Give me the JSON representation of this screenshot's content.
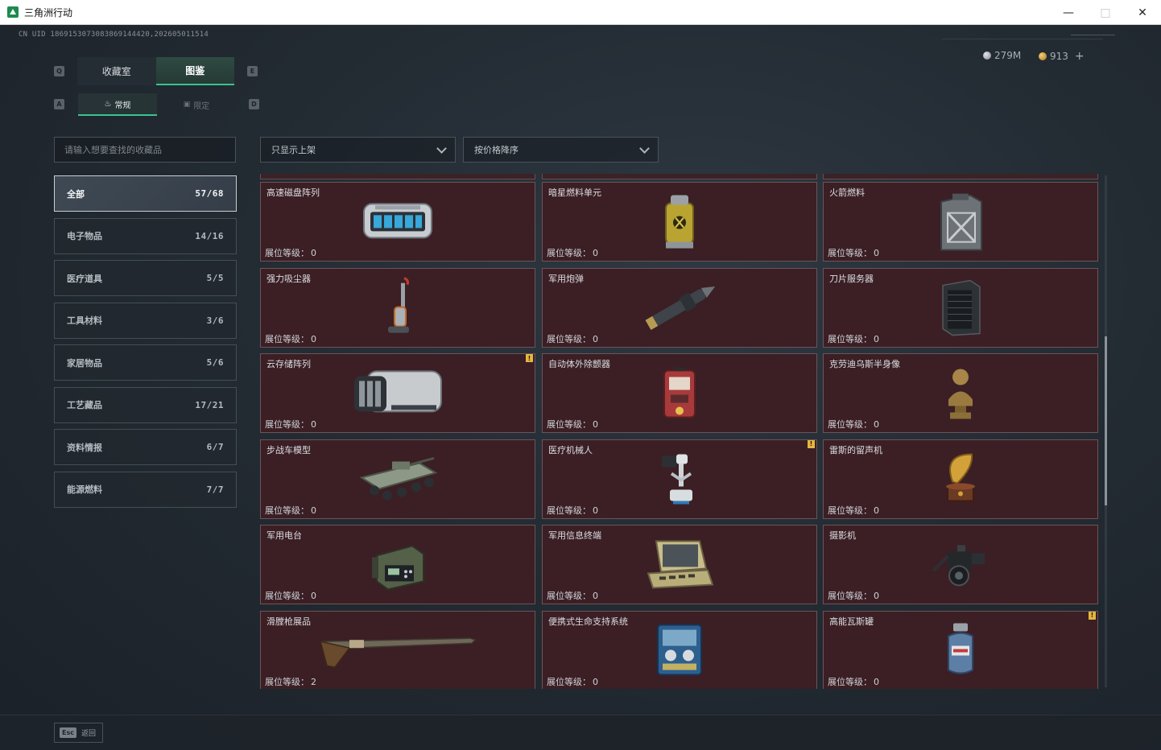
{
  "window": {
    "title": "三角洲行动"
  },
  "account": {
    "uid": "CN UID 1869153073083869144420,202605011514"
  },
  "currency": {
    "silver": "279M",
    "gold": "913",
    "add": "+"
  },
  "keyhints": {
    "q": "Q",
    "e": "E",
    "a": "A",
    "d": "D"
  },
  "tabs": {
    "main": [
      "收藏室",
      "图鉴"
    ],
    "sub": [
      "常规",
      "限定"
    ]
  },
  "search": {
    "placeholder": "请输入想要查找的收藏品"
  },
  "filters": {
    "listed": "只显示上架",
    "sort": "按价格降序"
  },
  "categories": [
    {
      "label": "全部",
      "count": "57/68"
    },
    {
      "label": "电子物品",
      "count": "14/16"
    },
    {
      "label": "医疗道具",
      "count": "5/5"
    },
    {
      "label": "工具材料",
      "count": "3/6"
    },
    {
      "label": "家居物品",
      "count": "5/6"
    },
    {
      "label": "工艺藏品",
      "count": "17/21"
    },
    {
      "label": "资料情报",
      "count": "6/7"
    },
    {
      "label": "能源燃料",
      "count": "7/7"
    }
  ],
  "level_label": "展位等级：",
  "items": [
    {
      "name": "高速磁盘阵列",
      "level": "0",
      "icon": "disk-array-icon"
    },
    {
      "name": "暗星燃料单元",
      "level": "0",
      "icon": "fuel-cell-icon"
    },
    {
      "name": "火箭燃料",
      "level": "0",
      "icon": "jerrycan-icon"
    },
    {
      "name": "强力吸尘器",
      "level": "0",
      "icon": "vacuum-icon"
    },
    {
      "name": "军用炮弹",
      "level": "0",
      "icon": "shell-icon"
    },
    {
      "name": "刀片服务器",
      "level": "0",
      "icon": "server-icon"
    },
    {
      "name": "云存储阵列",
      "level": "0",
      "icon": "storage-array-icon",
      "flag": "!"
    },
    {
      "name": "自动体外除颤器",
      "level": "0",
      "icon": "defibrillator-icon"
    },
    {
      "name": "克劳迪乌斯半身像",
      "level": "0",
      "icon": "bust-icon"
    },
    {
      "name": "步战车模型",
      "level": "0",
      "icon": "ifv-model-icon"
    },
    {
      "name": "医疗机械人",
      "level": "0",
      "icon": "medical-robot-icon",
      "flag": "!"
    },
    {
      "name": "雷斯的留声机",
      "level": "0",
      "icon": "gramophone-icon"
    },
    {
      "name": "军用电台",
      "level": "0",
      "icon": "radio-icon"
    },
    {
      "name": "军用信息终端",
      "level": "0",
      "icon": "terminal-icon"
    },
    {
      "name": "摄影机",
      "level": "0",
      "icon": "camera-icon"
    },
    {
      "name": "滑膛枪展品",
      "level": "2",
      "icon": "musket-icon"
    },
    {
      "name": "便携式生命支持系统",
      "level": "0",
      "icon": "life-support-icon"
    },
    {
      "name": "高能瓦斯罐",
      "level": "0",
      "icon": "gas-canister-icon",
      "flag": "!"
    }
  ],
  "footer": {
    "esc_key": "Esc",
    "back": "返回"
  }
}
